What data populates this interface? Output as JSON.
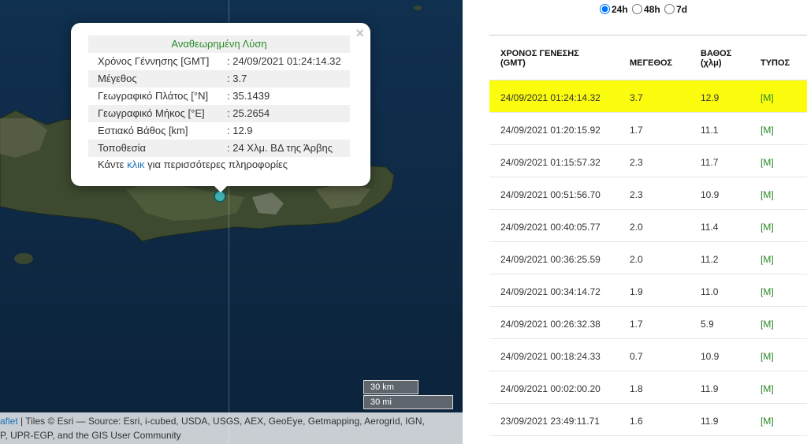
{
  "popup": {
    "title": "Αναθεωρημένη Λύση",
    "close": "×",
    "rows": [
      {
        "label": "Χρόνος Γέννησης [GMT]",
        "value": ": 24/09/2021 01:24:14.32"
      },
      {
        "label": "Μέγεθος",
        "value": ": 3.7"
      },
      {
        "label": "Γεωγραφικό Πλάτος [°N]",
        "value": ": 35.1439"
      },
      {
        "label": "Γεωγραφικό Μήκος [°E]",
        "value": ": 25.2654"
      },
      {
        "label": "Εστιακό Βάθος [km]",
        "value": ": 12.9"
      },
      {
        "label": "Τοποθεσία",
        "value": ": 24 Χλμ. ΒΔ της Άρβης"
      }
    ],
    "more_prefix": "Κάντε ",
    "more_link": "κλικ",
    "more_suffix": " για περισσότερες πληροφορίες"
  },
  "map": {
    "scale_km": "30 km",
    "scale_mi": "30 mi",
    "attribution_link": "aflet",
    "attribution_line1": " | Tiles © Esri — Source: Esri, i-cubed, USDA, USGS, AEX, GeoEye, Getmapping, Aerogrid, IGN,",
    "attribution_line2": "P, UPR-EGP, and the GIS User Community",
    "marker_color": "#3fb6b4"
  },
  "filters": {
    "options": [
      "24h",
      "48h",
      "7d"
    ],
    "selected": "24h"
  },
  "table": {
    "headers": {
      "time_l1": "ΧΡΟΝΟΣ ΓΕΝΕΣΗΣ",
      "time_l2": "(GMT)",
      "magnitude": "ΜΕΓΕΘΟΣ",
      "depth_l1": "ΒΑΘΟΣ",
      "depth_l2": "(χλμ)",
      "type": "ΤΥΠΟΣ"
    },
    "rows": [
      {
        "time": "24/09/2021 01:24:14.32",
        "mag": "3.7",
        "depth": "12.9",
        "type": "[M]"
      },
      {
        "time": "24/09/2021 01:20:15.92",
        "mag": "1.7",
        "depth": "11.1",
        "type": "[M]"
      },
      {
        "time": "24/09/2021 01:15:57.32",
        "mag": "2.3",
        "depth": "11.7",
        "type": "[M]"
      },
      {
        "time": "24/09/2021 00:51:56.70",
        "mag": "2.3",
        "depth": "10.9",
        "type": "[M]"
      },
      {
        "time": "24/09/2021 00:40:05.77",
        "mag": "2.0",
        "depth": "11.4",
        "type": "[M]"
      },
      {
        "time": "24/09/2021 00:36:25.59",
        "mag": "2.0",
        "depth": "11.2",
        "type": "[M]"
      },
      {
        "time": "24/09/2021 00:34:14.72",
        "mag": "1.9",
        "depth": "11.0",
        "type": "[M]"
      },
      {
        "time": "24/09/2021 00:26:32.38",
        "mag": "1.7",
        "depth": "5.9",
        "type": "[M]"
      },
      {
        "time": "24/09/2021 00:18:24.33",
        "mag": "0.7",
        "depth": "10.9",
        "type": "[M]"
      },
      {
        "time": "24/09/2021 00:02:00.20",
        "mag": "1.8",
        "depth": "11.9",
        "type": "[M]"
      },
      {
        "time": "23/09/2021 23:49:11.71",
        "mag": "1.6",
        "depth": "11.9",
        "type": "[M]"
      }
    ],
    "highlight_color": "#fcfc0f",
    "type_color": "#2a8a2a"
  }
}
